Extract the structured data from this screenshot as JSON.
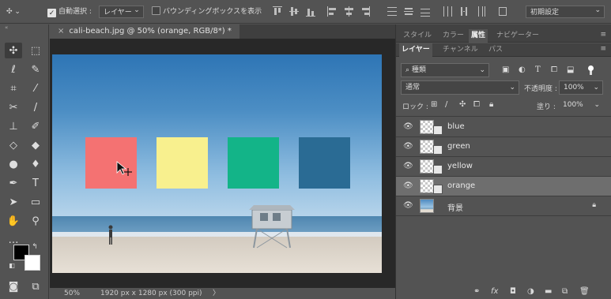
{
  "options_bar": {
    "auto_select_label": "自動選択 :",
    "auto_select_target": "レイヤー",
    "transform_controls_label": "バウンディングボックスを表示",
    "workspace": "初期設定"
  },
  "document": {
    "tab_title": "cali-beach.jpg @ 50% (orange, RGB/8*) *",
    "close_glyph": "×"
  },
  "canvas": {
    "squares": [
      {
        "name": "orange",
        "color": "#f47272"
      },
      {
        "name": "yellow",
        "color": "#f8f08e"
      },
      {
        "name": "green",
        "color": "#13b488"
      },
      {
        "name": "blue",
        "color": "#2a6b94"
      }
    ]
  },
  "status": {
    "zoom": "50%",
    "doc_info": "1920 px x 1280 px (300 ppi)",
    "arrow": "〉"
  },
  "panels": {
    "top_tabs": [
      "スタイル",
      "カラー",
      "属性",
      "ナビゲーター"
    ],
    "layer_tabs": [
      "レイヤー",
      "チャンネル",
      "パス"
    ],
    "filter_kind": "種類",
    "blend_mode": "通常",
    "opacity_label": "不透明度 :",
    "opacity_value": "100%",
    "lock_label": "ロック :",
    "fill_label": "塗り :",
    "fill_value": "100%",
    "layers": [
      {
        "name": "blue",
        "selected": false
      },
      {
        "name": "green",
        "selected": false
      },
      {
        "name": "yellow",
        "selected": false
      },
      {
        "name": "orange",
        "selected": true
      },
      {
        "name": "背景",
        "selected": false
      }
    ]
  }
}
